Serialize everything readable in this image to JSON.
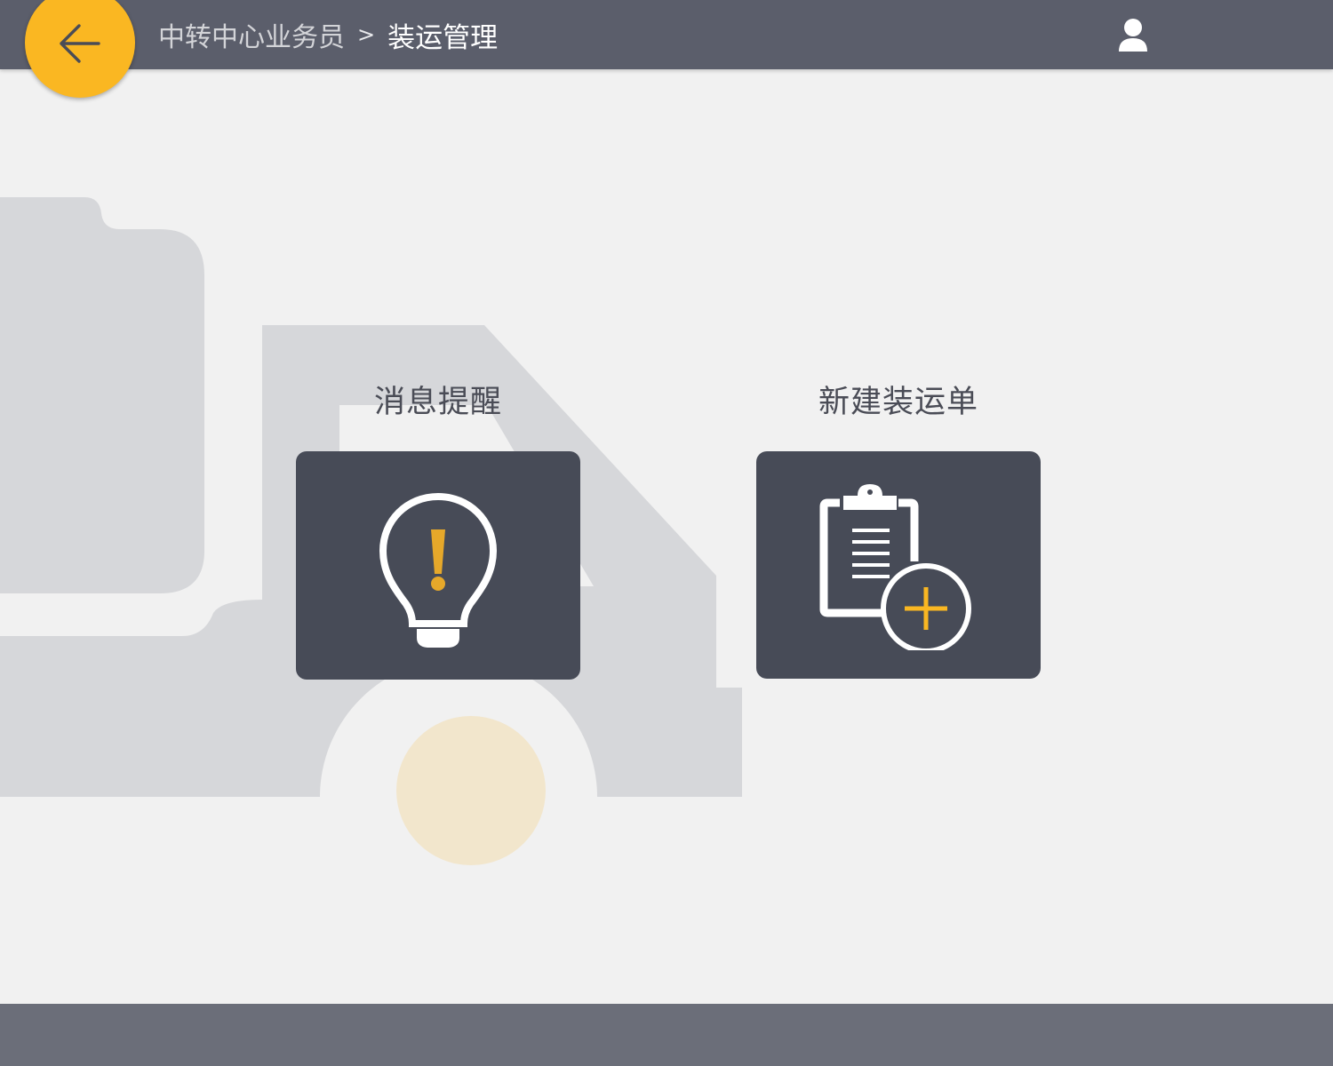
{
  "header": {
    "back_icon": "arrow-left-icon",
    "breadcrumb": {
      "parent": "中转中心业务员",
      "separator": ">",
      "current": "装运管理"
    },
    "user_icon": "user-icon"
  },
  "tiles": [
    {
      "label": "消息提醒",
      "icon": "lightbulb-alert-icon"
    },
    {
      "label": "新建装运单",
      "icon": "clipboard-add-icon"
    }
  ],
  "colors": {
    "header_bg": "#5b5e6b",
    "accent": "#fab722",
    "tile_bg": "#474b57",
    "page_bg": "#f1f1f1",
    "footer_bg": "#6b6e79"
  }
}
